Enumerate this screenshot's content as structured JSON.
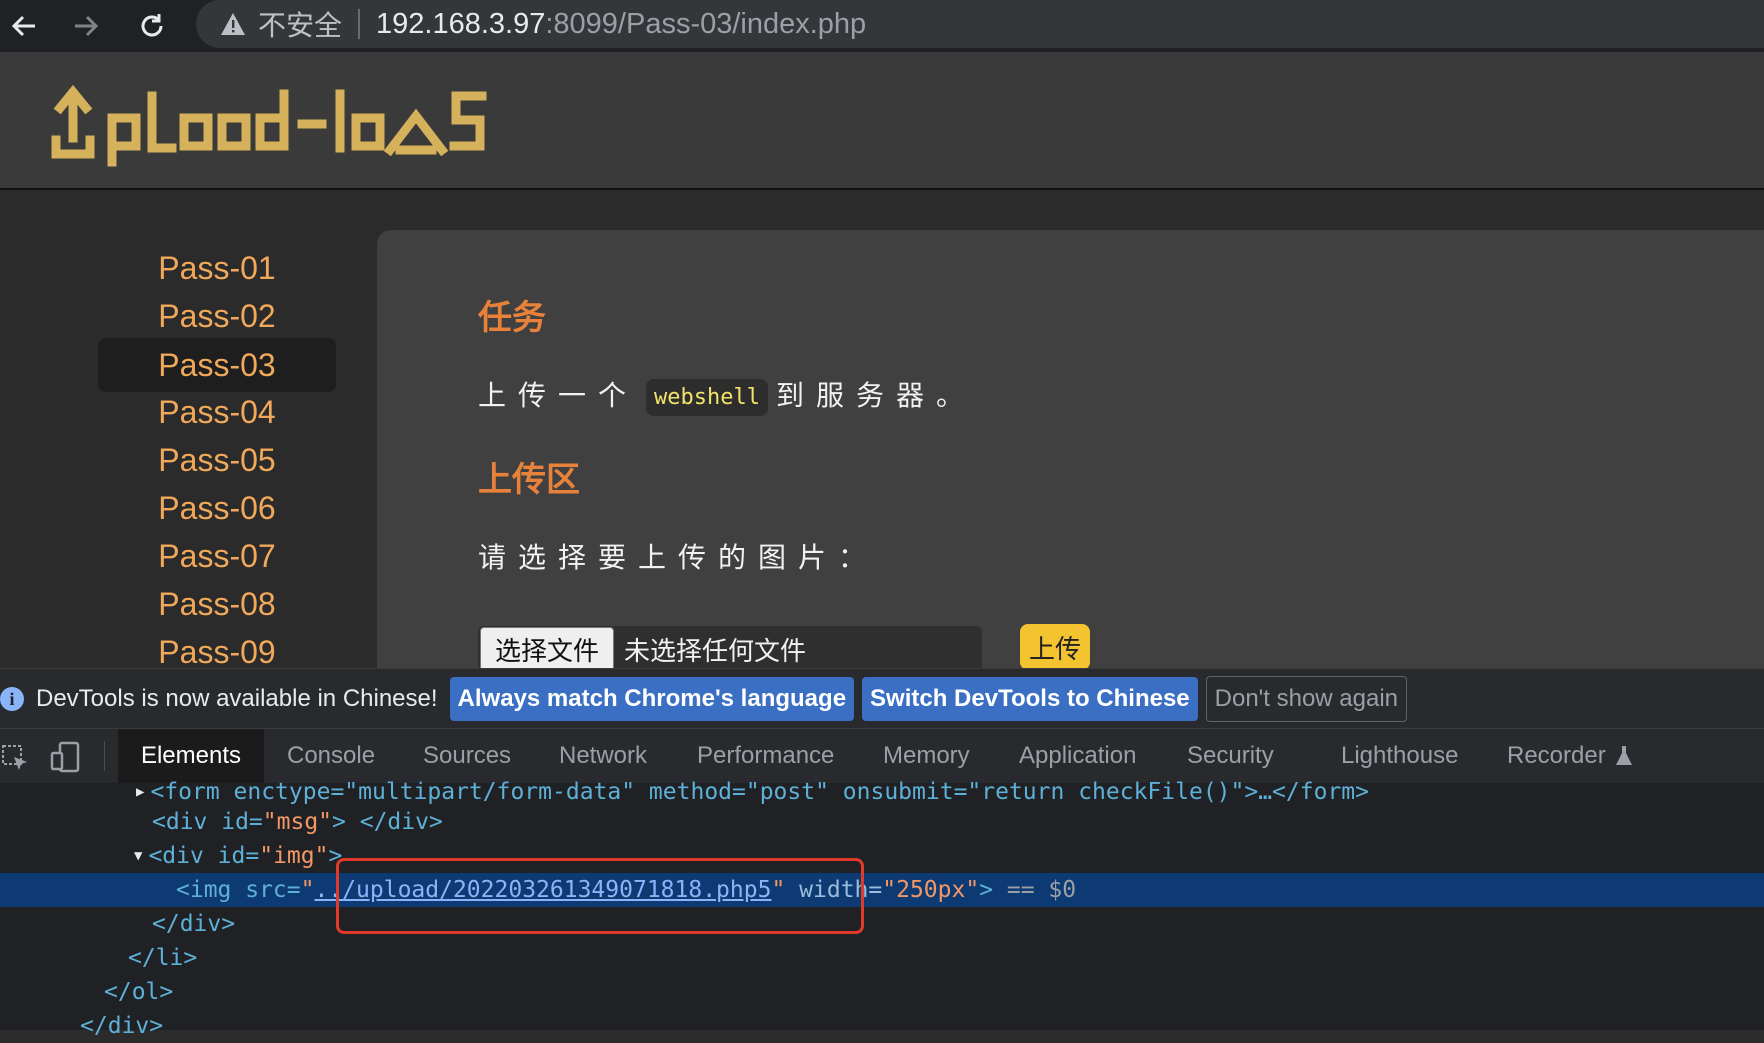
{
  "browser": {
    "security_label": "不安全",
    "url_host": "192.168.3.97",
    "url_path": ":8099/Pass-03/index.php"
  },
  "site": {
    "logo_text": "UpLoad-labs",
    "sidebar": {
      "items": [
        {
          "label": "Pass-01"
        },
        {
          "label": "Pass-02"
        },
        {
          "label": "Pass-03"
        },
        {
          "label": "Pass-04"
        },
        {
          "label": "Pass-05"
        },
        {
          "label": "Pass-06"
        },
        {
          "label": "Pass-07"
        },
        {
          "label": "Pass-08"
        },
        {
          "label": "Pass-09"
        }
      ],
      "active": "Pass-03"
    },
    "task_heading": "任务",
    "task_text_before": "上传一个",
    "task_code": "webshell",
    "task_text_after": "到服务器。",
    "upload_heading": "上传区",
    "upload_prompt": "请选择要上传的图片：",
    "file_button": "选择文件",
    "file_status": "未选择任何文件",
    "upload_button": "上传"
  },
  "devtools": {
    "notice": {
      "text": "DevTools is now available in Chinese!",
      "btn_match": "Always match Chrome's language",
      "btn_switch": "Switch DevTools to Chinese",
      "btn_dismiss": "Don't show again"
    },
    "tabs": [
      {
        "label": "Elements"
      },
      {
        "label": "Console"
      },
      {
        "label": "Sources"
      },
      {
        "label": "Network"
      },
      {
        "label": "Performance"
      },
      {
        "label": "Memory"
      },
      {
        "label": "Application"
      },
      {
        "label": "Security"
      },
      {
        "label": "Lighthouse"
      },
      {
        "label": "Recorder"
      }
    ],
    "code": {
      "line1": "<form enctype=\"multipart/form-data\" method=\"post\" onsubmit=\"return checkFile()\">…</form>",
      "line2_open": "<div id=",
      "line2_val": "\"msg\"",
      "line2_close": "> </div>",
      "line3_open": "<div id=",
      "line3_val": "\"img\"",
      "line3_close": ">",
      "line4_tag": "<img src=",
      "line4_q1": "\"",
      "line4_link": "../upload/202203261349071818.php5",
      "line4_q2": "\"",
      "line4_attr": " width=",
      "line4_val": "\"250px\"",
      "line4_end": ">",
      "line4_eq": " == $0",
      "line5": "</div>",
      "line6": "</li>",
      "line7": "</ol>",
      "line8": "</div>"
    }
  },
  "colors": {
    "accent_orange": "#e8823a",
    "upload_yellow": "#f4c430",
    "devtools_blue": "#3a6fc4",
    "highlight_red": "#e03a2b"
  }
}
